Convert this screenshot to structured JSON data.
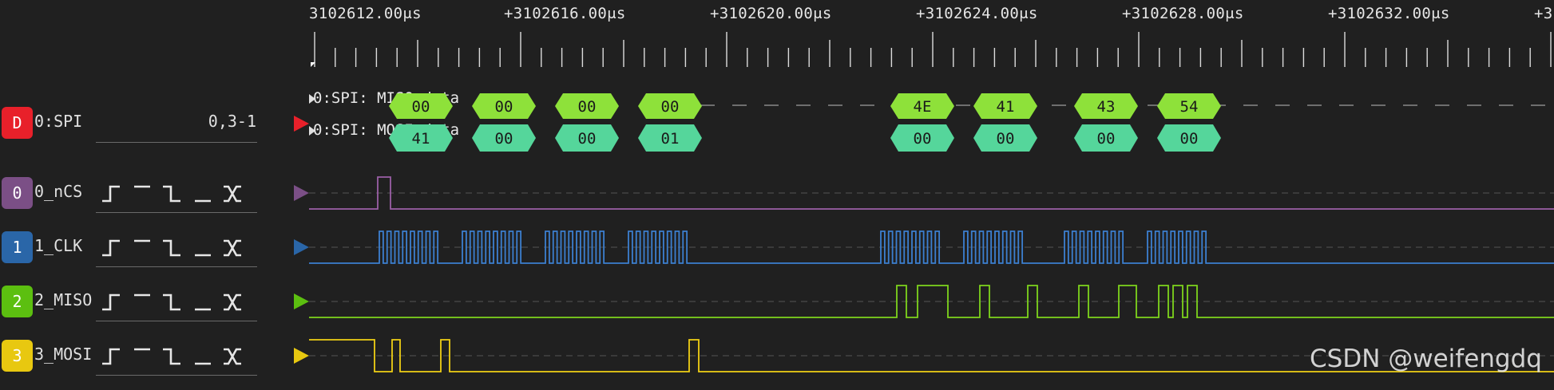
{
  "ruler": {
    "labels": [
      "3102612.00μs",
      "+3102616.00μs",
      "+3102620.00μs",
      "+3102624.00μs",
      "+3102628.00μs",
      "+3102632.00μs",
      "+3"
    ]
  },
  "decoder": {
    "badge": "D",
    "name": "0:SPI",
    "value": "0,3-1",
    "color": "#e8202a",
    "miso_label": "0:SPI: MISO data",
    "mosi_label": "0:SPI: MOSI data",
    "annotations": [
      "N",
      "A",
      "C",
      "T"
    ],
    "miso_bytes": [
      "00",
      "00",
      "00",
      "00",
      "4E",
      "41",
      "43",
      "54"
    ],
    "mosi_bytes": [
      "41",
      "00",
      "00",
      "01",
      "00",
      "00",
      "00",
      "00"
    ]
  },
  "channels": [
    {
      "badge": "0",
      "name": "0_nCS",
      "color": "#7b4f86",
      "wave": "#9b5fa6"
    },
    {
      "badge": "1",
      "name": "1_CLK",
      "color": "#2a66a8",
      "wave": "#3c7fd0"
    },
    {
      "badge": "2",
      "name": "2_MISO",
      "color": "#5cbf10",
      "wave": "#7ed41c"
    },
    {
      "badge": "3",
      "name": "3_MOSI",
      "color": "#e8c810",
      "wave": "#f0cf14"
    }
  ],
  "trigger_icons": [
    "rising-edge-icon",
    "high-level-icon",
    "falling-edge-icon",
    "low-level-icon",
    "any-edge-icon"
  ],
  "watermark": "CSDN @weifengdq"
}
